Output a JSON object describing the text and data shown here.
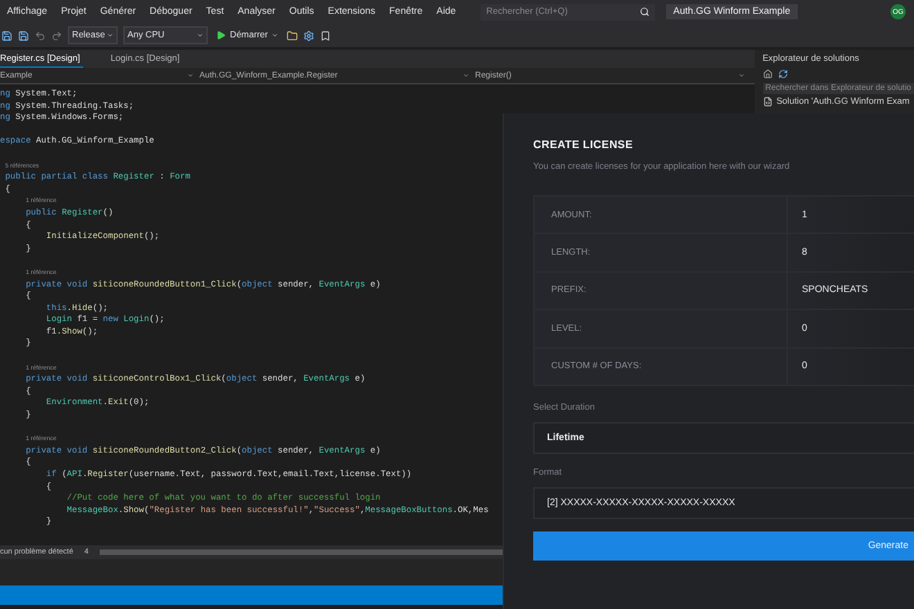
{
  "menu": [
    "Affichage",
    "Projet",
    "Générer",
    "Déboguer",
    "Test",
    "Analyser",
    "Outils",
    "Extensions",
    "Fenêtre",
    "Aide"
  ],
  "search": {
    "placeholder": "Rechercher (Ctrl+Q)"
  },
  "window_title": "Auth.GG Winform Example",
  "account_initials": "OG",
  "toolbar": {
    "configuration": "Release",
    "platform": "Any CPU",
    "run_button": "Démarrer"
  },
  "editor_tabs": [
    {
      "label": "Register.cs [Design]",
      "selected": true
    },
    {
      "label": "Login.cs [Design]",
      "selected": false
    }
  ],
  "navigation": {
    "project": "Example",
    "class": "Auth.GG_Winform_Example.Register",
    "member": "Register()"
  },
  "code_lines": [
    {
      "kind": "code",
      "segments": [
        {
          "kind": "keyword",
          "text": "ng"
        },
        {
          "kind": "plain",
          "text": " System.Text;"
        }
      ]
    },
    {
      "kind": "code",
      "segments": [
        {
          "kind": "keyword",
          "text": "ng"
        },
        {
          "kind": "plain",
          "text": " System.Threading.Tasks;"
        }
      ]
    },
    {
      "kind": "code",
      "segments": [
        {
          "kind": "keyword",
          "text": "ng"
        },
        {
          "kind": "plain",
          "text": " System.Windows.Forms;"
        }
      ]
    },
    {
      "kind": "blank"
    },
    {
      "kind": "code",
      "segments": [
        {
          "kind": "keyword",
          "text": "espace"
        },
        {
          "kind": "plain",
          "text": " Auth.GG_Winform_Example"
        }
      ]
    },
    {
      "kind": "blank"
    },
    {
      "kind": "lens",
      "text": " 5 références"
    },
    {
      "kind": "code",
      "segments": [
        {
          "kind": "keyword",
          "text": " public partial class "
        },
        {
          "kind": "type",
          "text": "Register"
        },
        {
          "kind": "plain",
          "text": " : "
        },
        {
          "kind": "type",
          "text": "Form"
        }
      ]
    },
    {
      "kind": "code",
      "segments": [
        {
          "kind": "plain",
          "text": " {"
        }
      ]
    },
    {
      "kind": "lens",
      "text": "     1 référence"
    },
    {
      "kind": "code",
      "segments": [
        {
          "kind": "keyword",
          "text": "     public "
        },
        {
          "kind": "type",
          "text": "Register"
        },
        {
          "kind": "plain",
          "text": "()"
        }
      ]
    },
    {
      "kind": "code",
      "segments": [
        {
          "kind": "plain",
          "text": "     {"
        }
      ]
    },
    {
      "kind": "code",
      "segments": [
        {
          "kind": "method",
          "text": "         InitializeComponent"
        },
        {
          "kind": "plain",
          "text": "();"
        }
      ]
    },
    {
      "kind": "code",
      "segments": [
        {
          "kind": "plain",
          "text": "     }"
        }
      ]
    },
    {
      "kind": "blank"
    },
    {
      "kind": "lens",
      "text": "     1 référence"
    },
    {
      "kind": "code",
      "segments": [
        {
          "kind": "keyword",
          "text": "     private void "
        },
        {
          "kind": "method",
          "text": "siticoneRoundedButton1_Click"
        },
        {
          "kind": "plain",
          "text": "("
        },
        {
          "kind": "keyword",
          "text": "object"
        },
        {
          "kind": "plain",
          "text": " sender, "
        },
        {
          "kind": "type",
          "text": "EventArgs"
        },
        {
          "kind": "plain",
          "text": " e)"
        }
      ]
    },
    {
      "kind": "code",
      "segments": [
        {
          "kind": "plain",
          "text": "     {"
        }
      ]
    },
    {
      "kind": "code",
      "segments": [
        {
          "kind": "keyword",
          "text": "         this"
        },
        {
          "kind": "plain",
          "text": "."
        },
        {
          "kind": "method",
          "text": "Hide"
        },
        {
          "kind": "plain",
          "text": "();"
        }
      ]
    },
    {
      "kind": "code",
      "segments": [
        {
          "kind": "type",
          "text": "         Login"
        },
        {
          "kind": "plain",
          "text": " f1 = "
        },
        {
          "kind": "keyword",
          "text": "new "
        },
        {
          "kind": "type",
          "text": "Login"
        },
        {
          "kind": "plain",
          "text": "();"
        }
      ]
    },
    {
      "kind": "code",
      "segments": [
        {
          "kind": "plain",
          "text": "         f1."
        },
        {
          "kind": "method",
          "text": "Show"
        },
        {
          "kind": "plain",
          "text": "();"
        }
      ]
    },
    {
      "kind": "code",
      "segments": [
        {
          "kind": "plain",
          "text": "     }"
        }
      ]
    },
    {
      "kind": "blank"
    },
    {
      "kind": "lens",
      "text": "     1 référence"
    },
    {
      "kind": "code",
      "segments": [
        {
          "kind": "keyword",
          "text": "     private void "
        },
        {
          "kind": "method",
          "text": "siticoneControlBox1_Click"
        },
        {
          "kind": "plain",
          "text": "("
        },
        {
          "kind": "keyword",
          "text": "object"
        },
        {
          "kind": "plain",
          "text": " sender, "
        },
        {
          "kind": "type",
          "text": "EventArgs"
        },
        {
          "kind": "plain",
          "text": " e)"
        }
      ]
    },
    {
      "kind": "code",
      "segments": [
        {
          "kind": "plain",
          "text": "     {"
        }
      ]
    },
    {
      "kind": "code",
      "segments": [
        {
          "kind": "type",
          "text": "         Environment"
        },
        {
          "kind": "plain",
          "text": "."
        },
        {
          "kind": "method",
          "text": "Exit"
        },
        {
          "kind": "plain",
          "text": "(0);"
        }
      ]
    },
    {
      "kind": "code",
      "segments": [
        {
          "kind": "plain",
          "text": "     }"
        }
      ]
    },
    {
      "kind": "blank"
    },
    {
      "kind": "lens",
      "text": "     1 référence"
    },
    {
      "kind": "code",
      "segments": [
        {
          "kind": "keyword",
          "text": "     private void "
        },
        {
          "kind": "method",
          "text": "siticoneRoundedButton2_Click"
        },
        {
          "kind": "plain",
          "text": "("
        },
        {
          "kind": "keyword",
          "text": "object"
        },
        {
          "kind": "plain",
          "text": " sender, "
        },
        {
          "kind": "type",
          "text": "EventArgs"
        },
        {
          "kind": "plain",
          "text": " e)"
        }
      ]
    },
    {
      "kind": "code",
      "segments": [
        {
          "kind": "plain",
          "text": "     {"
        }
      ]
    },
    {
      "kind": "code",
      "segments": [
        {
          "kind": "keyword",
          "text": "         if"
        },
        {
          "kind": "plain",
          "text": " ("
        },
        {
          "kind": "type",
          "text": "API"
        },
        {
          "kind": "plain",
          "text": "."
        },
        {
          "kind": "method",
          "text": "Register"
        },
        {
          "kind": "plain",
          "text": "(username.Text, password.Text,email.Text,license.Text))"
        }
      ]
    },
    {
      "kind": "code",
      "segments": [
        {
          "kind": "plain",
          "text": "         {"
        }
      ]
    },
    {
      "kind": "code",
      "segments": [
        {
          "kind": "comment",
          "text": "             //Put code here of what you want to do after successful login"
        }
      ]
    },
    {
      "kind": "code",
      "segments": [
        {
          "kind": "type",
          "text": "             MessageBox"
        },
        {
          "kind": "plain",
          "text": "."
        },
        {
          "kind": "method",
          "text": "Show"
        },
        {
          "kind": "plain",
          "text": "("
        },
        {
          "kind": "string",
          "text": "\"Register has been successful!\""
        },
        {
          "kind": "plain",
          "text": ","
        },
        {
          "kind": "string",
          "text": "\"Success\""
        },
        {
          "kind": "plain",
          "text": ","
        },
        {
          "kind": "type",
          "text": "MessageBoxButtons"
        },
        {
          "kind": "plain",
          "text": ".OK,Mes"
        }
      ]
    },
    {
      "kind": "code",
      "segments": [
        {
          "kind": "plain",
          "text": "         }"
        }
      ]
    }
  ],
  "status": {
    "problems": "cun problème détecté",
    "column": "4"
  },
  "solution_explorer": {
    "title": "Explorateur de solutions",
    "search": {
      "placeholder": "Rechercher dans Explorateur de solutio"
    },
    "items": [
      {
        "label": "Solution 'Auth.GG Winform Exam"
      }
    ]
  },
  "license_panel": {
    "title": "CREATE LICENSE",
    "subtitle": "You can create licenses for your application here with our wizard",
    "fields": [
      {
        "label": "AMOUNT:",
        "value": "1"
      },
      {
        "label": "LENGTH:",
        "value": "8"
      },
      {
        "label": "PREFIX:",
        "value": "SPONCHEATS"
      },
      {
        "label": "LEVEL:",
        "value": "0"
      },
      {
        "label": "CUSTOM # OF DAYS:",
        "value": "0"
      }
    ],
    "duration": {
      "label": "Select Duration",
      "value": "Lifetime"
    },
    "format": {
      "label": "Format",
      "value": "[2] XXXXX-XXXXX-XXXXX-XXXXX-XXXXX"
    },
    "generate_button": "Generate"
  }
}
